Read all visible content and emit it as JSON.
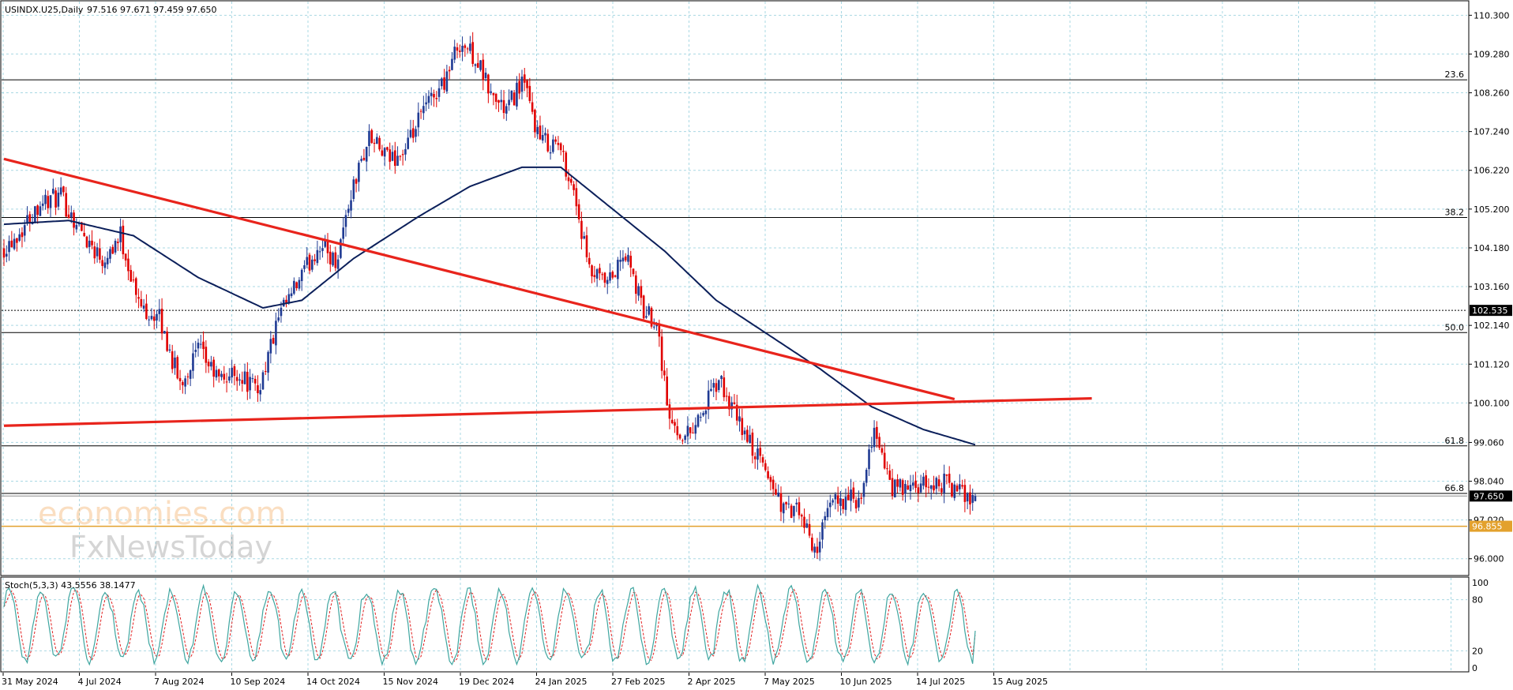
{
  "header": {
    "symbol_label": "USINDX.U25,Daily",
    "ohlc_label": "97.516 97.671 97.459 97.650"
  },
  "stoch_header": {
    "label": "Stoch(5,3,3) 43.5556 38.1477"
  },
  "watermark": {
    "line1": "economies.com",
    "line2": "FxNewsToday"
  },
  "colors": {
    "bull": "#1f3a93",
    "bear": "#e00000",
    "ma": "#0b1f5a",
    "trend": "#e8241c",
    "fib": "#000000",
    "current_price_badge": "#000000",
    "support_line": "#e3a12d",
    "stoch_main": "#3fa6a0",
    "stoch_signal": "#e02020",
    "grid": "#a9d8e3"
  },
  "chart_data": [
    {
      "type": "candlestick",
      "title": "USINDX.U25,Daily",
      "y_axis_ticks": [
        "110.300",
        "109.280",
        "108.260",
        "107.240",
        "106.220",
        "105.200",
        "104.180",
        "103.160",
        "102.140",
        "101.120",
        "100.100",
        "99.060",
        "98.040",
        "97.020",
        "96.000"
      ],
      "ylim": [
        95.6,
        110.66
      ],
      "x_axis_ticks": [
        "31 May 2024",
        "4 Jul 2024",
        "7 Aug 2024",
        "10 Sep 2024",
        "14 Oct 2024",
        "15 Nov 2024",
        "19 Dec 2024",
        "24 Jan 2025",
        "27 Feb 2025",
        "2 Apr 2025",
        "7 May 2025",
        "10 Jun 2025",
        "14 Jul 2025",
        "15 Aug 2025"
      ],
      "close_path_keypoints": [
        {
          "t": 0,
          "v": 104.2
        },
        {
          "t": 6,
          "v": 104.6
        },
        {
          "t": 14,
          "v": 105.4
        },
        {
          "t": 22,
          "v": 105.5
        },
        {
          "t": 30,
          "v": 104.6
        },
        {
          "t": 38,
          "v": 103.9
        },
        {
          "t": 45,
          "v": 104.5
        },
        {
          "t": 52,
          "v": 102.7
        },
        {
          "t": 60,
          "v": 102.3
        },
        {
          "t": 68,
          "v": 100.6
        },
        {
          "t": 75,
          "v": 101.5
        },
        {
          "t": 83,
          "v": 100.7
        },
        {
          "t": 90,
          "v": 100.9
        },
        {
          "t": 98,
          "v": 100.4
        },
        {
          "t": 106,
          "v": 102.3
        },
        {
          "t": 114,
          "v": 103.3
        },
        {
          "t": 122,
          "v": 104.3
        },
        {
          "t": 128,
          "v": 103.8
        },
        {
          "t": 134,
          "v": 105.6
        },
        {
          "t": 141,
          "v": 107.1
        },
        {
          "t": 148,
          "v": 106.5
        },
        {
          "t": 155,
          "v": 106.7
        },
        {
          "t": 162,
          "v": 107.8
        },
        {
          "t": 170,
          "v": 108.6
        },
        {
          "t": 176,
          "v": 109.6
        },
        {
          "t": 182,
          "v": 109.2
        },
        {
          "t": 188,
          "v": 108.2
        },
        {
          "t": 194,
          "v": 107.8
        },
        {
          "t": 200,
          "v": 108.6
        },
        {
          "t": 207,
          "v": 107.0
        },
        {
          "t": 214,
          "v": 106.9
        },
        {
          "t": 220,
          "v": 105.7
        },
        {
          "t": 226,
          "v": 103.5
        },
        {
          "t": 233,
          "v": 103.2
        },
        {
          "t": 240,
          "v": 104.0
        },
        {
          "t": 247,
          "v": 102.5
        },
        {
          "t": 252,
          "v": 102.3
        },
        {
          "t": 257,
          "v": 99.6
        },
        {
          "t": 263,
          "v": 99.2
        },
        {
          "t": 270,
          "v": 99.9
        },
        {
          "t": 276,
          "v": 100.7
        },
        {
          "t": 282,
          "v": 99.8
        },
        {
          "t": 289,
          "v": 98.9
        },
        {
          "t": 295,
          "v": 98.2
        },
        {
          "t": 301,
          "v": 97.3
        },
        {
          "t": 307,
          "v": 97.2
        },
        {
          "t": 313,
          "v": 96.2
        },
        {
          "t": 320,
          "v": 97.5
        },
        {
          "t": 326,
          "v": 97.6
        },
        {
          "t": 331,
          "v": 97.4
        },
        {
          "t": 336,
          "v": 99.5
        },
        {
          "t": 342,
          "v": 97.9
        },
        {
          "t": 349,
          "v": 97.8
        },
        {
          "t": 356,
          "v": 97.9
        },
        {
          "t": 363,
          "v": 98.0
        },
        {
          "t": 370,
          "v": 97.7
        },
        {
          "t": 375,
          "v": 97.65
        }
      ],
      "last_bar": {
        "open": 97.516,
        "high": 97.671,
        "low": 97.459,
        "close": 97.65
      },
      "moving_average_keypoints": [
        {
          "t": 0,
          "v": 104.8
        },
        {
          "t": 25,
          "v": 104.9
        },
        {
          "t": 50,
          "v": 104.5
        },
        {
          "t": 75,
          "v": 103.4
        },
        {
          "t": 100,
          "v": 102.6
        },
        {
          "t": 115,
          "v": 102.8
        },
        {
          "t": 135,
          "v": 103.9
        },
        {
          "t": 160,
          "v": 105.0
        },
        {
          "t": 180,
          "v": 105.8
        },
        {
          "t": 200,
          "v": 106.3
        },
        {
          "t": 215,
          "v": 106.3
        },
        {
          "t": 235,
          "v": 105.2
        },
        {
          "t": 255,
          "v": 104.1
        },
        {
          "t": 275,
          "v": 102.8
        },
        {
          "t": 295,
          "v": 101.9
        },
        {
          "t": 315,
          "v": 101.0
        },
        {
          "t": 335,
          "v": 100.0
        },
        {
          "t": 355,
          "v": 99.4
        },
        {
          "t": 375,
          "v": 99.0
        }
      ],
      "fibonacci_levels": [
        {
          "label": "23.6",
          "value": 108.6
        },
        {
          "label": "38.2",
          "value": 104.98
        },
        {
          "label": "50.0",
          "value": 101.95
        },
        {
          "label": "61.8",
          "value": 98.97
        },
        {
          "label": "66.8",
          "value": 97.72
        }
      ],
      "horizontal_levels": [
        {
          "label": "102.535",
          "value": 102.535,
          "style": "dotted"
        },
        {
          "label": "96.855",
          "value": 96.855,
          "style": "support"
        }
      ],
      "current_price": "97.650",
      "trendlines": [
        {
          "name": "descending",
          "from": {
            "t": 0,
            "v": 106.52
          },
          "to": {
            "t": 367,
            "v": 100.2
          }
        },
        {
          "name": "ascending",
          "from": {
            "t": 0,
            "v": 99.5
          },
          "to": {
            "t": 420,
            "v": 100.22
          }
        }
      ]
    },
    {
      "type": "line",
      "title": "Stoch(5,3,3) 43.5556 38.1477",
      "y_axis_ticks": [
        "100",
        "80",
        "20",
        "0"
      ],
      "ylim": [
        0,
        100
      ],
      "series": [
        {
          "name": "main",
          "last": 43.5556
        },
        {
          "name": "signal",
          "last": 38.1477
        }
      ]
    }
  ]
}
